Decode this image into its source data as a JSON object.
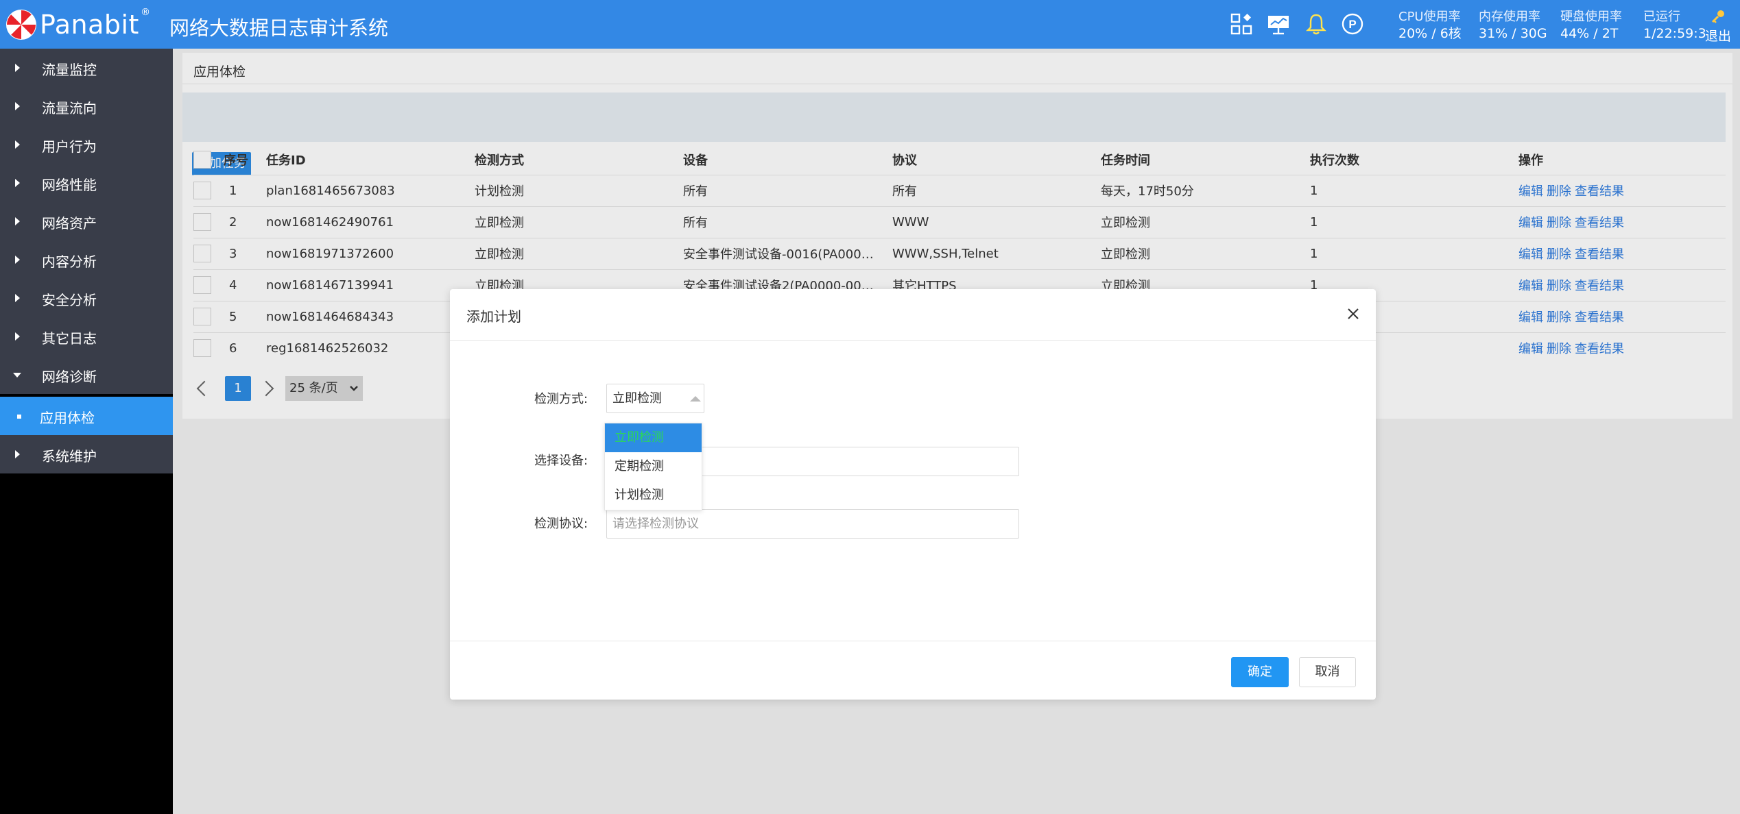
{
  "header": {
    "brand": "Panabit",
    "brand_mark": "®",
    "title": "网络大数据日志审计系统",
    "stats": [
      {
        "label": "CPU使用率",
        "value": "20% / 6核"
      },
      {
        "label": "内存使用率",
        "value": "31% / 30G"
      },
      {
        "label": "硬盘使用率",
        "value": "44% / 2T"
      },
      {
        "label": "已运行",
        "value": "1/22:59:3"
      }
    ],
    "logout": "退出",
    "icons": [
      "dashboard-icon",
      "monitor-icon",
      "bell-icon",
      "profile-p-icon",
      "key-icon"
    ]
  },
  "sidebar": {
    "items": [
      {
        "label": "流量监控"
      },
      {
        "label": "流量流向"
      },
      {
        "label": "用户行为"
      },
      {
        "label": "网络性能"
      },
      {
        "label": "网络资产"
      },
      {
        "label": "内容分析"
      },
      {
        "label": "安全分析"
      },
      {
        "label": "其它日志"
      },
      {
        "label": "网络诊断"
      },
      {
        "label": "应用体检"
      },
      {
        "label": "系统维护"
      }
    ]
  },
  "main": {
    "breadcrumb": "应用体检",
    "add_task": "添加任务",
    "table": {
      "headers": [
        "序号",
        "任务ID",
        "检测方式",
        "设备",
        "协议",
        "任务时间",
        "执行次数",
        "操作"
      ],
      "rows": [
        {
          "no": "1",
          "id": "plan1681465673083",
          "method": "计划检测",
          "device": "所有",
          "protocol": "所有",
          "time": "每天，17时50分",
          "count": "1"
        },
        {
          "no": "2",
          "id": "now1681462490761",
          "method": "立即检测",
          "device": "所有",
          "protocol": "WWW",
          "time": "立即检测",
          "count": "1"
        },
        {
          "no": "3",
          "id": "now1681971372600",
          "method": "立即检测",
          "device": "安全事件测试设备-0016(PA000…",
          "protocol": "WWW,SSH,Telnet",
          "time": "立即检测",
          "count": "1"
        },
        {
          "no": "4",
          "id": "now1681467139941",
          "method": "立即检测",
          "device": "安全事件测试设备2(PA0000-00…",
          "protocol": "其它HTTPS",
          "time": "立即检测",
          "count": "1"
        },
        {
          "no": "5",
          "id": "now1681464684343",
          "method": "",
          "device": "",
          "protocol": "",
          "time": "",
          "count": ""
        },
        {
          "no": "6",
          "id": "reg1681462526032",
          "method": "",
          "device": "",
          "protocol": "",
          "time": "",
          "count": ""
        }
      ],
      "actions": [
        "编辑",
        "删除",
        "查看结果"
      ]
    },
    "pager": {
      "current": "1",
      "page_size": "25 条/页"
    }
  },
  "dialog": {
    "title": "添加计划",
    "method_label": "检测方式:",
    "method_value": "立即检测",
    "method_options": [
      "立即检测",
      "定期检测",
      "计划检测"
    ],
    "device_label": "选择设备:",
    "device_placeholder": "",
    "protocol_label": "检测协议:",
    "protocol_placeholder": "请选择检测协议",
    "ok": "确定",
    "cancel": "取消"
  }
}
